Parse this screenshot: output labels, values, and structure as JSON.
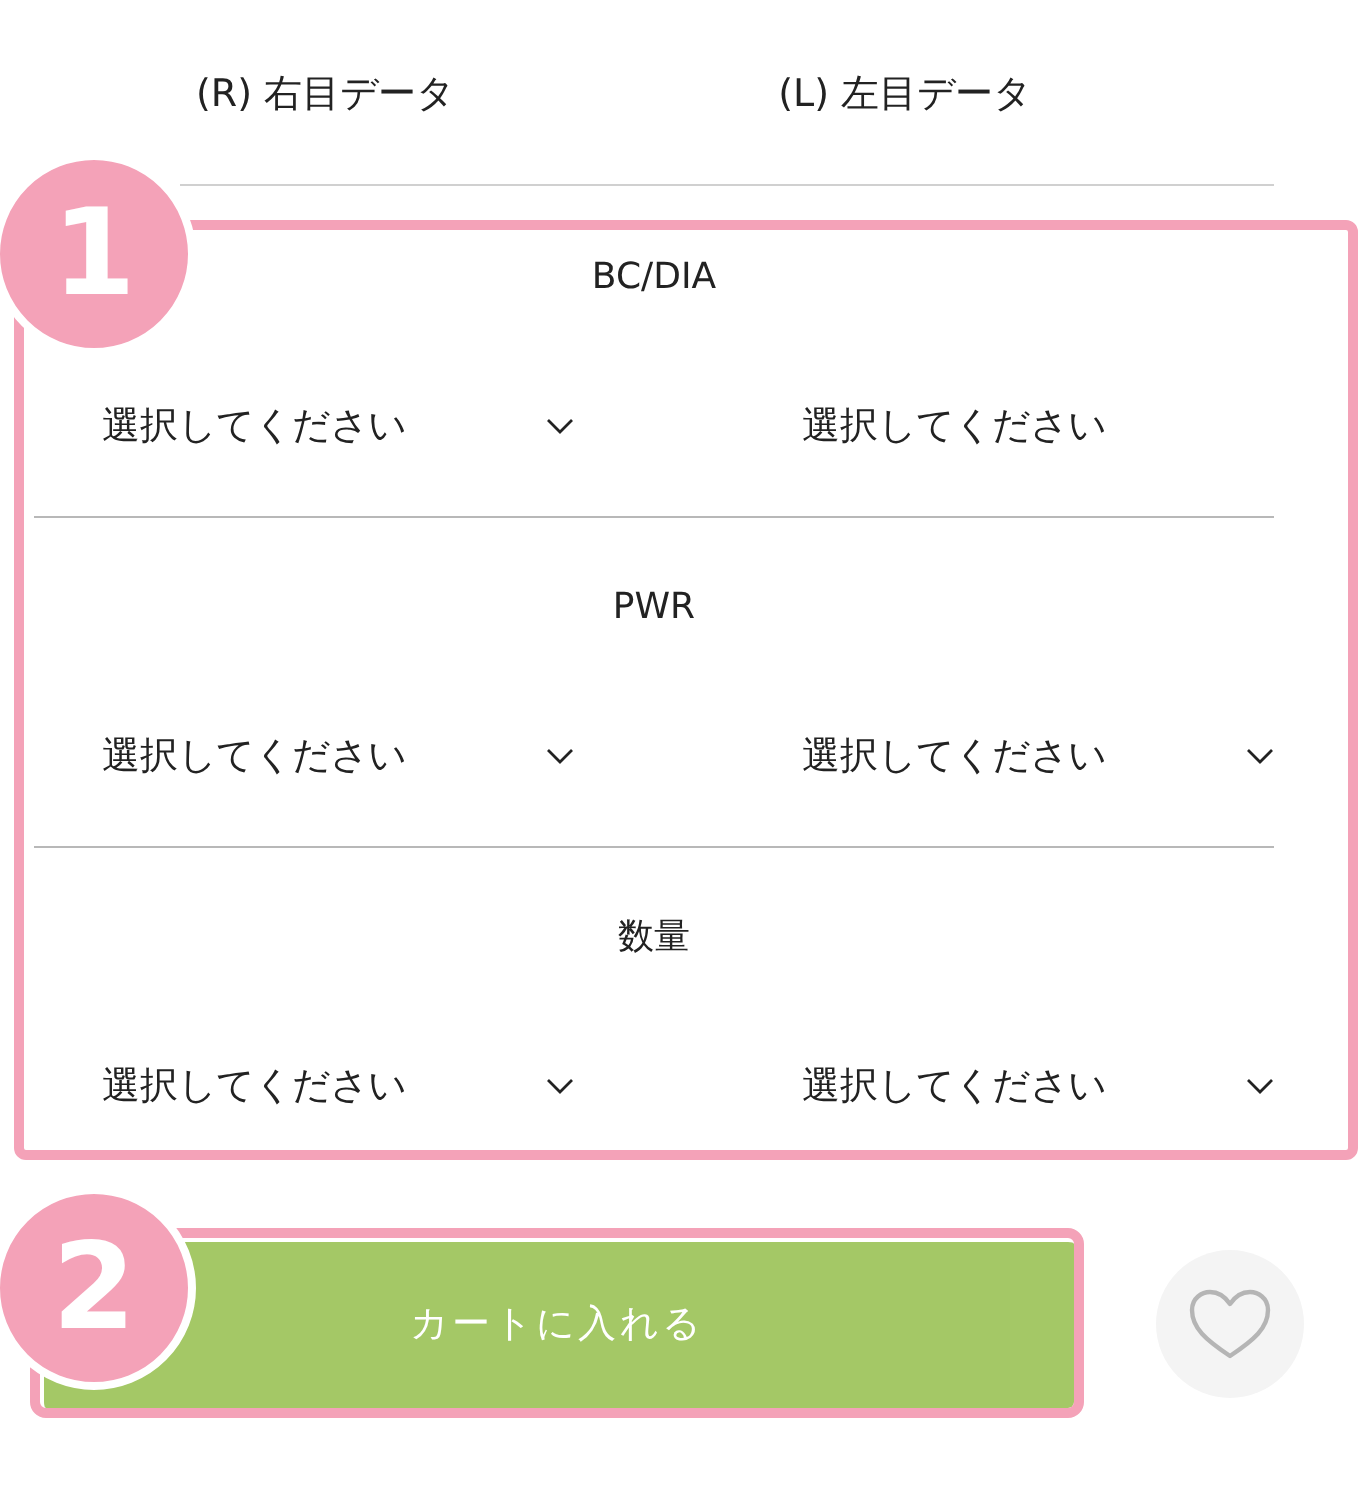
{
  "eye_headers": [
    "(R) 右目データ",
    "(L) 左目データ"
  ],
  "step_badges": [
    "1",
    "2"
  ],
  "sections": [
    {
      "label": "BC/DIA",
      "selects": [
        {
          "value": "選択してください",
          "caret": true
        },
        {
          "value": "選択してください",
          "caret": false
        }
      ]
    },
    {
      "label": "PWR",
      "selects": [
        {
          "value": "選択してください",
          "caret": true
        },
        {
          "value": "選択してください",
          "caret": true
        }
      ]
    },
    {
      "label": "数量",
      "selects": [
        {
          "value": "選択してください",
          "caret": true
        },
        {
          "value": "選択してください",
          "caret": true
        }
      ]
    }
  ],
  "cart_button": {
    "label": "カートに入れる"
  }
}
